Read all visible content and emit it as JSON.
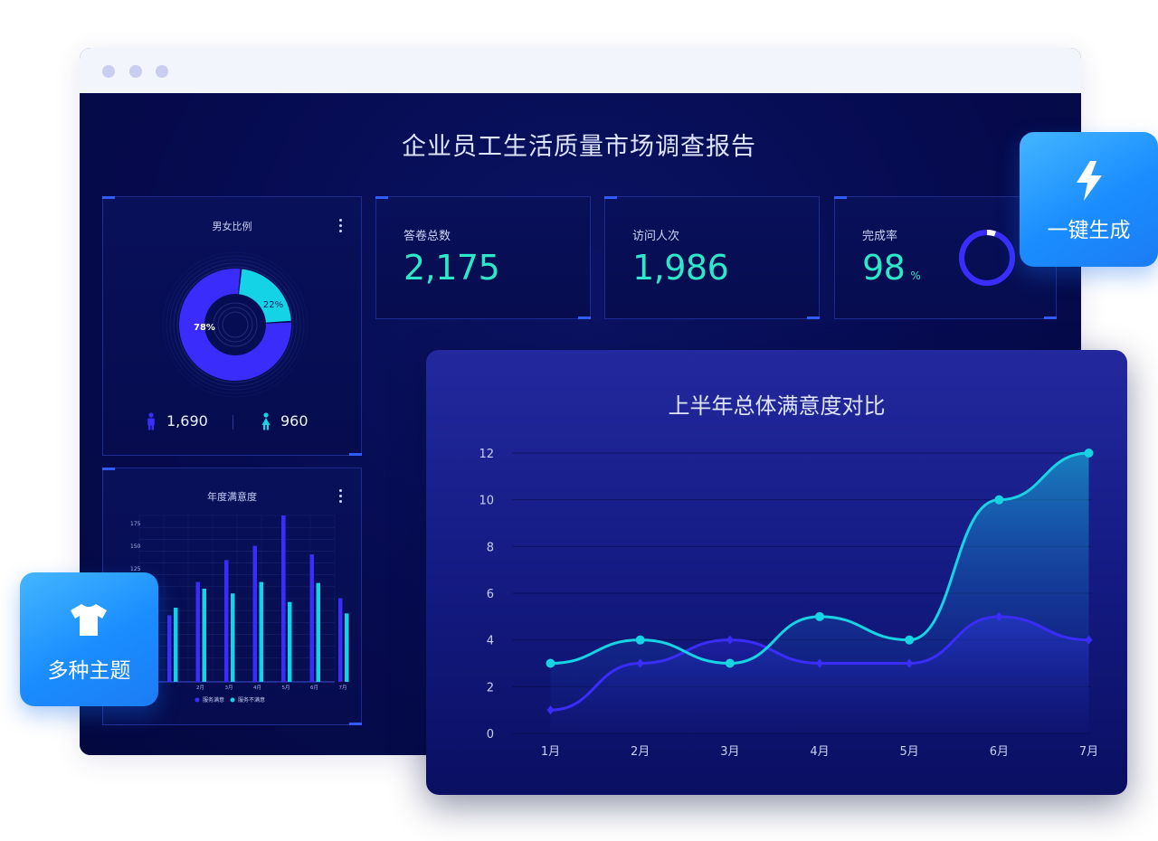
{
  "window": {
    "control_dots": 3
  },
  "dashboard": {
    "title": "企业员工生活质量市场调查报告",
    "gender_panel": {
      "title": "男女比例",
      "male_percent_label": "78%",
      "female_percent_label": "22%",
      "male_count": "1,690",
      "female_count": "960",
      "colors": {
        "male": "#3a2dfc",
        "female": "#14d3e6"
      }
    },
    "stats": [
      {
        "label": "答卷总数",
        "value": "2,175"
      },
      {
        "label": "访问人次",
        "value": "1,986"
      },
      {
        "label": "完成率",
        "value": "98",
        "unit": "%",
        "ring_fraction": 0.98
      }
    ],
    "annual_panel": {
      "title": "年度满意度",
      "y_ticks": [
        "175",
        "150",
        "125"
      ],
      "x_labels": [
        "2月",
        "3月",
        "4月",
        "5月",
        "6月",
        "7月"
      ],
      "legend": [
        "服务满意",
        "服务不满意"
      ]
    }
  },
  "badges": {
    "generate": {
      "label": "一键生成",
      "icon": "lightning-icon"
    },
    "themes": {
      "label": "多种主题",
      "icon": "tshirt-icon"
    }
  },
  "overlay_chart": {
    "title": "上半年总体满意度对比"
  },
  "chart_data": [
    {
      "type": "bar",
      "title": "年度满意度",
      "categories": [
        "1月",
        "2月",
        "3月",
        "4月",
        "5月",
        "6月",
        "7月"
      ],
      "series": [
        {
          "name": "服务满意",
          "values": [
            70,
            105,
            128,
            143,
            175,
            134,
            88
          ]
        },
        {
          "name": "服务不满意",
          "values": [
            78,
            98,
            93,
            105,
            84,
            104,
            72
          ]
        }
      ],
      "ylim": [
        0,
        175
      ],
      "legend": "bottom",
      "colors": [
        "#3a2dfc",
        "#14d3e6"
      ]
    },
    {
      "type": "area",
      "title": "上半年总体满意度对比",
      "categories": [
        "1月",
        "2月",
        "3月",
        "4月",
        "5月",
        "6月",
        "7月"
      ],
      "series": [
        {
          "values": [
            3,
            4,
            3,
            5,
            4,
            10,
            12
          ],
          "color": "#17d4e4"
        },
        {
          "values": [
            1,
            3,
            4,
            3,
            3,
            5,
            4
          ],
          "color": "#3a2dfc"
        }
      ],
      "yticks": [
        0,
        2,
        4,
        6,
        8,
        10,
        12
      ],
      "ylim": [
        0,
        12
      ],
      "grid": true
    }
  ]
}
